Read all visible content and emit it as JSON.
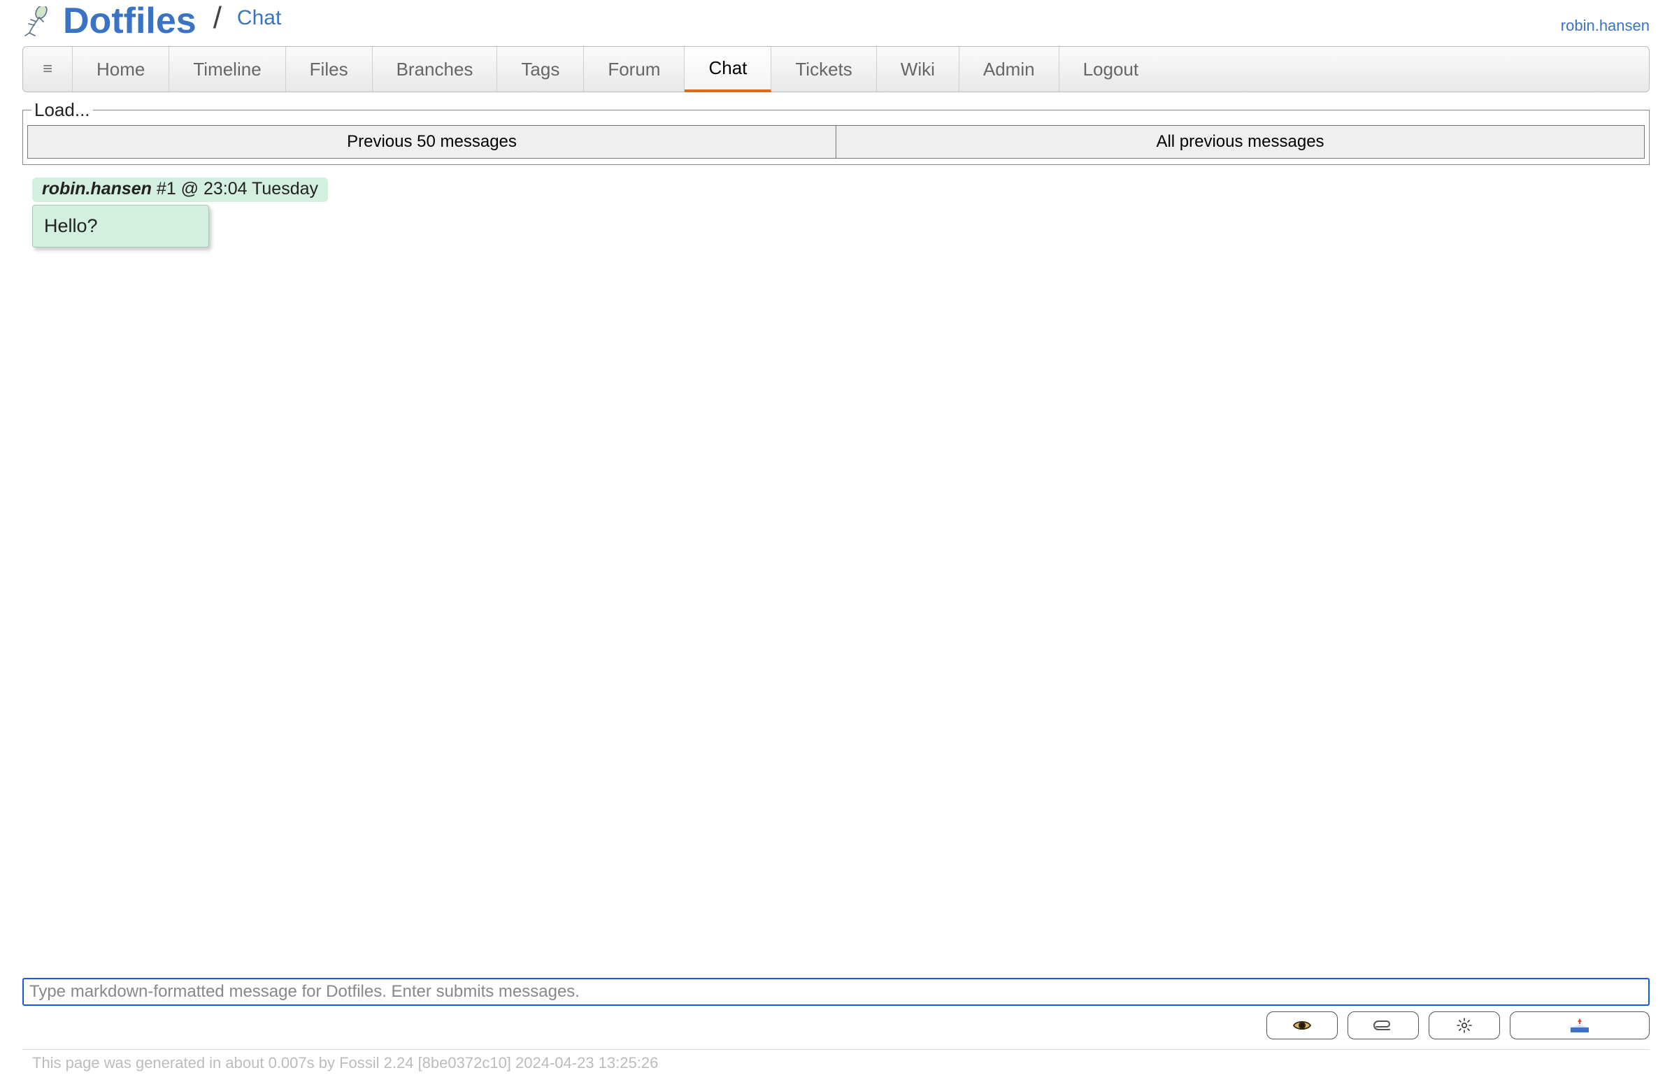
{
  "header": {
    "site_title": "Dotfiles",
    "separator": "/",
    "page_name": "Chat",
    "user": "robin.hansen"
  },
  "nav": {
    "menu_glyph": "≡",
    "items": [
      {
        "label": "Home",
        "active": false
      },
      {
        "label": "Timeline",
        "active": false
      },
      {
        "label": "Files",
        "active": false
      },
      {
        "label": "Branches",
        "active": false
      },
      {
        "label": "Tags",
        "active": false
      },
      {
        "label": "Forum",
        "active": false
      },
      {
        "label": "Chat",
        "active": true
      },
      {
        "label": "Tickets",
        "active": false
      },
      {
        "label": "Wiki",
        "active": false
      },
      {
        "label": "Admin",
        "active": false
      },
      {
        "label": "Logout",
        "active": false
      }
    ]
  },
  "load": {
    "legend": "Load...",
    "prev_label": "Previous 50 messages",
    "all_label": "All previous messages"
  },
  "messages": [
    {
      "author": "robin.hansen",
      "meta_tail": " #1 @ 23:04 Tuesday",
      "body": "Hello?"
    }
  ],
  "composer": {
    "placeholder": "Type markdown-formatted message for Dotfiles. Enter submits messages."
  },
  "footer": {
    "text": "This page was generated in about 0.007s by Fossil 2.24 [8be0372c10] 2024-04-23 13:25:26"
  }
}
